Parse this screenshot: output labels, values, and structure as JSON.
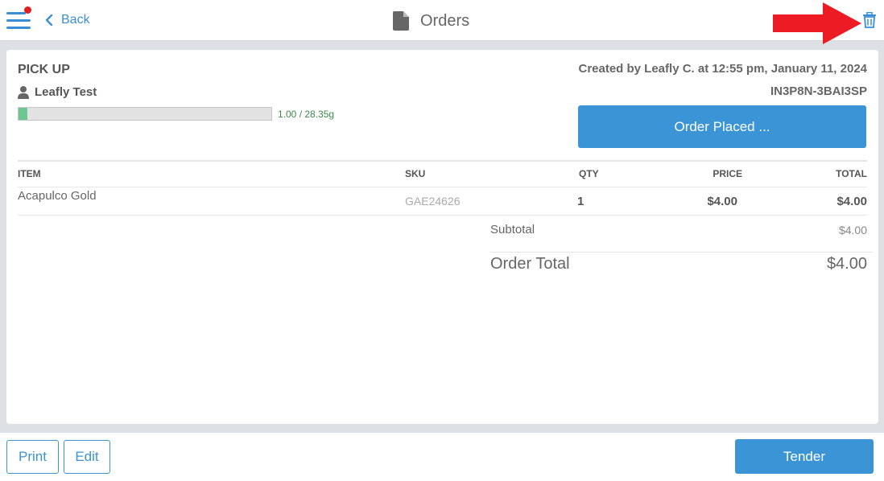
{
  "header": {
    "back_label": "Back",
    "title": "Orders",
    "menu_icon": "hamburger-menu-icon",
    "delete_icon": "trash-icon",
    "accent_color": "#3b94d5",
    "notification_color": "#e02020",
    "annotation_arrow_color": "#ed1c24"
  },
  "order": {
    "type": "PICK UP",
    "customer_name": "Leafly Test",
    "purchase_limit": {
      "text": "1.00 / 28.35g",
      "used": 1.0,
      "max": 28.35,
      "unit": "g"
    },
    "created_text": "Created by Leafly C. at 12:55 pm, January 11, 2024",
    "order_id": "IN3P8N-3BAI3SP",
    "status_label": "Order Placed ..."
  },
  "table": {
    "headers": {
      "item": "ITEM",
      "sku": "SKU",
      "qty": "QTY",
      "price": "PRICE",
      "total": "TOTAL"
    },
    "rows": [
      {
        "item": "Acapulco Gold",
        "sku": "GAE24626",
        "qty": "1",
        "price": "$4.00",
        "total": "$4.00"
      }
    ]
  },
  "summary": {
    "subtotal_label": "Subtotal",
    "subtotal_value": "$4.00",
    "order_total_label": "Order Total",
    "order_total_value": "$4.00"
  },
  "footer": {
    "print_label": "Print",
    "edit_label": "Edit",
    "tender_label": "Tender"
  }
}
